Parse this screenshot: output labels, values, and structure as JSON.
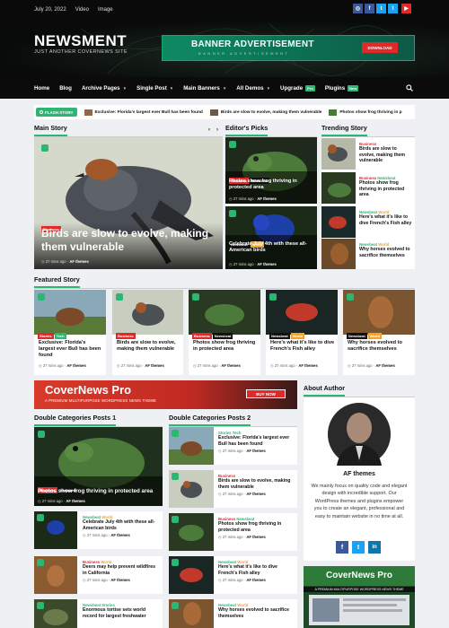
{
  "topbar": {
    "date": "July 20, 2022",
    "links": [
      "Video",
      "Image"
    ]
  },
  "social": [
    {
      "name": "instagram-icon",
      "glyph": "◎",
      "color": "#3b5998"
    },
    {
      "name": "facebook-icon",
      "glyph": "f",
      "color": "#3b5998"
    },
    {
      "name": "twitter-icon",
      "glyph": "t",
      "color": "#1da1f2"
    },
    {
      "name": "youtube-icon",
      "glyph": "▶",
      "color": "#e02a2a"
    }
  ],
  "header": {
    "logo": "NEWSMENT",
    "tagline": "JUST ANOTHER COVERNEWS SITE"
  },
  "banner": {
    "title": "BANNER ADVERTISEMENT",
    "subtitle": "BANNER ADVERTISEMENT",
    "button": "DOWNLOAD"
  },
  "nav": {
    "items": [
      {
        "label": "Home"
      },
      {
        "label": "Blog"
      },
      {
        "label": "Archive Pages",
        "caret": true
      },
      {
        "label": "Single Post",
        "caret": true
      },
      {
        "label": "Main Banners",
        "caret": true
      },
      {
        "label": "All Demos",
        "caret": true
      },
      {
        "label": "Upgrade",
        "badge": "Pro"
      },
      {
        "label": "Plugins",
        "badge": "New"
      }
    ]
  },
  "ticker": {
    "label": "FLASH STORY",
    "items": [
      "Exclusive: Florida's largest ever Bull has been found",
      "Birds are slow to evolve, making them vulnerable",
      "Photos show frog thriving in p"
    ]
  },
  "sections": {
    "main": "Main Story",
    "editors": "Editor's Picks",
    "trending": "Trending Story",
    "featured": "Featured Story",
    "dbl1": "Double Categories Posts 1",
    "dbl2": "Double Categories Posts 2",
    "about": "About Author"
  },
  "main_story": {
    "tag": "Business",
    "title": "Birds are slow to evolve, making them vulnerable",
    "time": "27 mins ago",
    "author": "AF themes"
  },
  "editors": [
    {
      "tags": [
        "Business",
        "Newsbeat"
      ],
      "title": "Photos show frog thriving in protected area",
      "time": "27 mins ago",
      "author": "AF themes"
    },
    {
      "tags": [
        "Newsbeat",
        "World"
      ],
      "title": "Celebrate July 4th with these all-American birds",
      "time": "27 mins ago",
      "author": "AF themes"
    }
  ],
  "trending": [
    {
      "cats": [
        "Business"
      ],
      "title": "Birds are slow to evolve, making them vulnerable"
    },
    {
      "cats": [
        "Business",
        "Newsbeat"
      ],
      "title": "Photos show frog thriving in protected area"
    },
    {
      "cats": [
        "Newsbeat",
        "World"
      ],
      "title": "Here's what it's like to dive French's Fish alley"
    },
    {
      "cats": [
        "Newsbeat",
        "World"
      ],
      "title": "Why horses evolved to sacrifice themselves"
    }
  ],
  "featured": [
    {
      "tags": [
        "Stories",
        "Tech"
      ],
      "title": "Exclusive: Florida's largest ever Bull has been found",
      "time": "27 mins ago",
      "author": "AF themes"
    },
    {
      "tags": [
        "Business"
      ],
      "title": "Birds are slow to evolve, making them vulnerable",
      "time": "27 mins ago",
      "author": "AF themes"
    },
    {
      "tags": [
        "Business",
        "Newsbeat"
      ],
      "title": "Photos show frog thriving in protected area",
      "time": "27 mins ago",
      "author": "AF themes"
    },
    {
      "tags": [
        "Newsbeat",
        "World"
      ],
      "title": "Here's what it's like to dive French's Fish alley",
      "time": "27 mins ago",
      "author": "AF themes"
    },
    {
      "tags": [
        "Newsbeat",
        "World"
      ],
      "title": "Why horses evolved to sacrifice themselves",
      "time": "27 mins ago",
      "author": "AF themes"
    }
  ],
  "ad": {
    "title": "CoverNews Pro",
    "subtitle": "A PREMIUM MULTIPURPOSE WORDPRESS NEWS THEME",
    "button": "BUY NOW"
  },
  "dbl1": {
    "big": {
      "tags": [
        "Business",
        "Newsbeat"
      ],
      "title": "Photos show frog thriving in protected area",
      "time": "27 mins ago",
      "author": "AF themes"
    },
    "list": [
      {
        "cats": [
          "Newsbeat",
          "World"
        ],
        "title": "Celebrate July 4th with these all-American birds",
        "time": "27 mins ago",
        "author": "AF themes"
      },
      {
        "cats": [
          "Business",
          "World"
        ],
        "title": "Deers may help prevent wildfires in California",
        "time": "27 mins ago",
        "author": "AF themes"
      },
      {
        "cats": [
          "Newsbeat",
          "Stories"
        ],
        "title": "Enormous tortise sets world record for largest freshwater"
      }
    ]
  },
  "dbl2": [
    {
      "cats": [
        "Stories",
        "Tech"
      ],
      "title": "Exclusive: Florida's largest ever Bull has been found",
      "time": "27 mins ago",
      "author": "AF themes"
    },
    {
      "cats": [
        "Business"
      ],
      "title": "Birds are slow to evolve, making them vulnerable",
      "time": "27 mins ago",
      "author": "AF themes"
    },
    {
      "cats": [
        "Business",
        "Newsbeat"
      ],
      "title": "Photos show frog thriving in protected area",
      "time": "27 mins ago",
      "author": "AF themes"
    },
    {
      "cats": [
        "Newsbeat",
        "World"
      ],
      "title": "Here's what it's like to dive French's Fish alley",
      "time": "27 mins ago",
      "author": "AF themes"
    },
    {
      "cats": [
        "Newsbeat",
        "World"
      ],
      "title": "Why horses evolved to sacrifice themselves"
    }
  ],
  "about": {
    "name": "AF themes",
    "bio": "We mainly focus on quality code and elegant design with incredible support. Our WordPress themes and plugins empower you to create an elegant, professional and easy to maintain website in no time at all."
  },
  "side_ad": {
    "title": "CoverNews Pro",
    "subtitle": "A PREMIUM MULTIPURPOSE WORDPRESS NEWS THEME"
  },
  "colors": {
    "accent": "#2bb673",
    "red": "#e02a2a"
  }
}
